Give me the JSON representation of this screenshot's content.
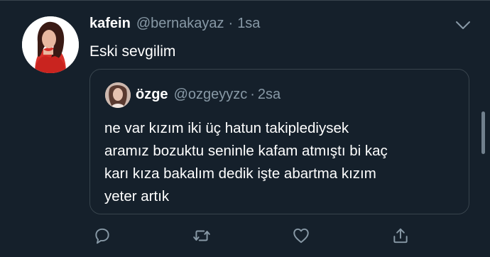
{
  "tweet": {
    "author": {
      "display_name": "kafein",
      "handle": "@bernakayaz",
      "separator": "·",
      "time": "1sa"
    },
    "text": "Eski sevgilim",
    "avatar": "profile-photo"
  },
  "quoted_tweet": {
    "author": {
      "display_name": "özge",
      "handle": "@ozgeyyzc",
      "separator": "·",
      "time": "2sa"
    },
    "text_lines": [
      "ne var kızım iki üç hatun takiplediysek",
      "aramız bozuktu seninle kafam atmıştı bi kaç",
      "karı kıza bakalım dedik işte abartma kızım",
      "yeter artık"
    ]
  },
  "actions": [
    "reply-icon",
    "retweet-icon",
    "like-icon",
    "share-icon"
  ],
  "colors": {
    "background": "#15202b",
    "border": "#38444d",
    "secondary_text": "#8899a6",
    "primary_text": "#ffffff"
  }
}
